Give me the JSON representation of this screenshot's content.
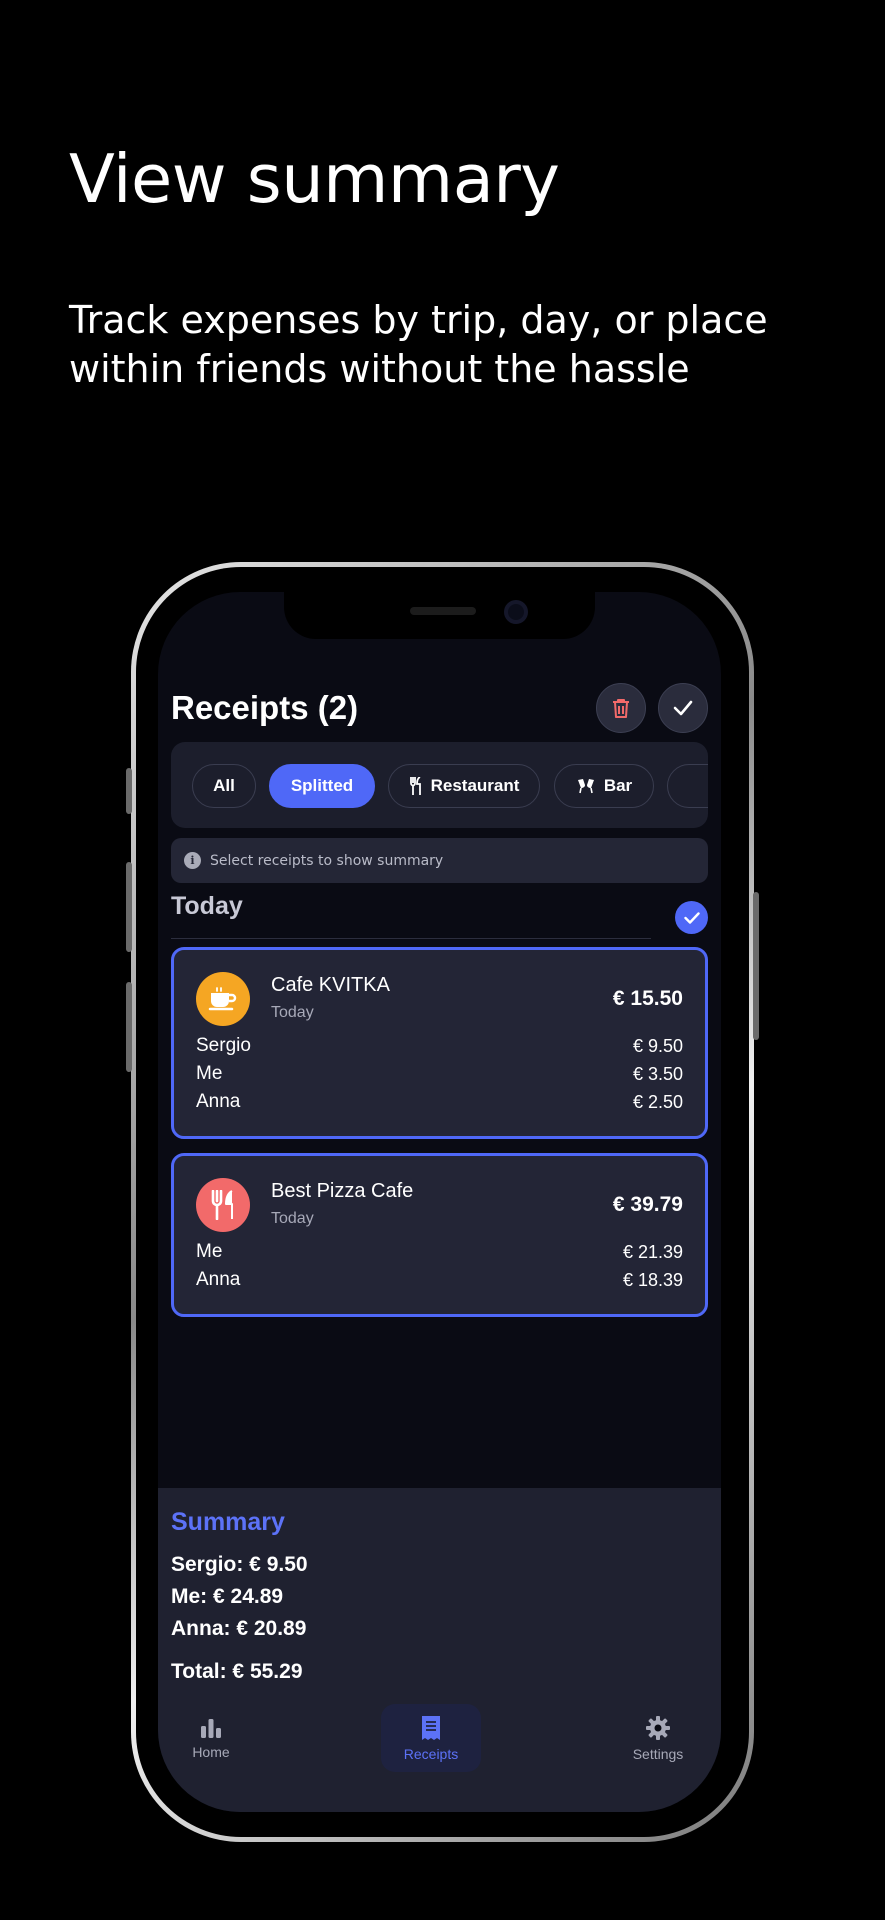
{
  "hero": {
    "title": "View summary",
    "subtitle": "Track expenses by trip, day, or place within friends without the hassle"
  },
  "screen": {
    "title": "Receipts (2)",
    "actions": {
      "delete_icon": "trash-icon",
      "confirm_icon": "checkmark-icon"
    }
  },
  "filters": [
    {
      "label": "All",
      "active": false
    },
    {
      "label": "Splitted",
      "active": true
    },
    {
      "label": "Restaurant",
      "icon": "fork-knife-icon",
      "active": false
    },
    {
      "label": "Bar",
      "icon": "glasses-cheers-icon",
      "active": false
    }
  ],
  "hint": {
    "text": "Select receipts to show summary",
    "icon": "info-icon"
  },
  "section": {
    "title": "Today",
    "selected": true
  },
  "receipts": [
    {
      "name": "Cafe KVITKA",
      "date": "Today",
      "total": "€ 15.50",
      "icon": "coffee-cup-icon",
      "icon_color": "#f5a623",
      "splits": [
        {
          "person": "Sergio",
          "amount": "€ 9.50"
        },
        {
          "person": "Me",
          "amount": "€ 3.50"
        },
        {
          "person": "Anna",
          "amount": "€ 2.50"
        }
      ]
    },
    {
      "name": "Best Pizza Cafe",
      "date": "Today",
      "total": "€ 39.79",
      "icon": "fork-knife-icon",
      "icon_color": "#f26a6a",
      "splits": [
        {
          "person": "Me",
          "amount": "€ 21.39"
        },
        {
          "person": "Anna",
          "amount": "€ 18.39"
        }
      ]
    }
  ],
  "summary": {
    "title": "Summary",
    "lines": [
      "Sergio: € 9.50",
      "Me: € 24.89",
      "Anna: € 20.89"
    ],
    "total": "Total: € 55.29"
  },
  "tabs": [
    {
      "label": "Home",
      "icon": "bar-chart-icon",
      "active": false
    },
    {
      "label": "Receipts",
      "icon": "receipt-icon",
      "active": true
    },
    {
      "label": "Settings",
      "icon": "gear-icon",
      "active": false
    }
  ],
  "colors": {
    "accent": "#4f68f7",
    "background": "#0a0b14",
    "card": "#232536",
    "delete": "#f26a6a"
  }
}
